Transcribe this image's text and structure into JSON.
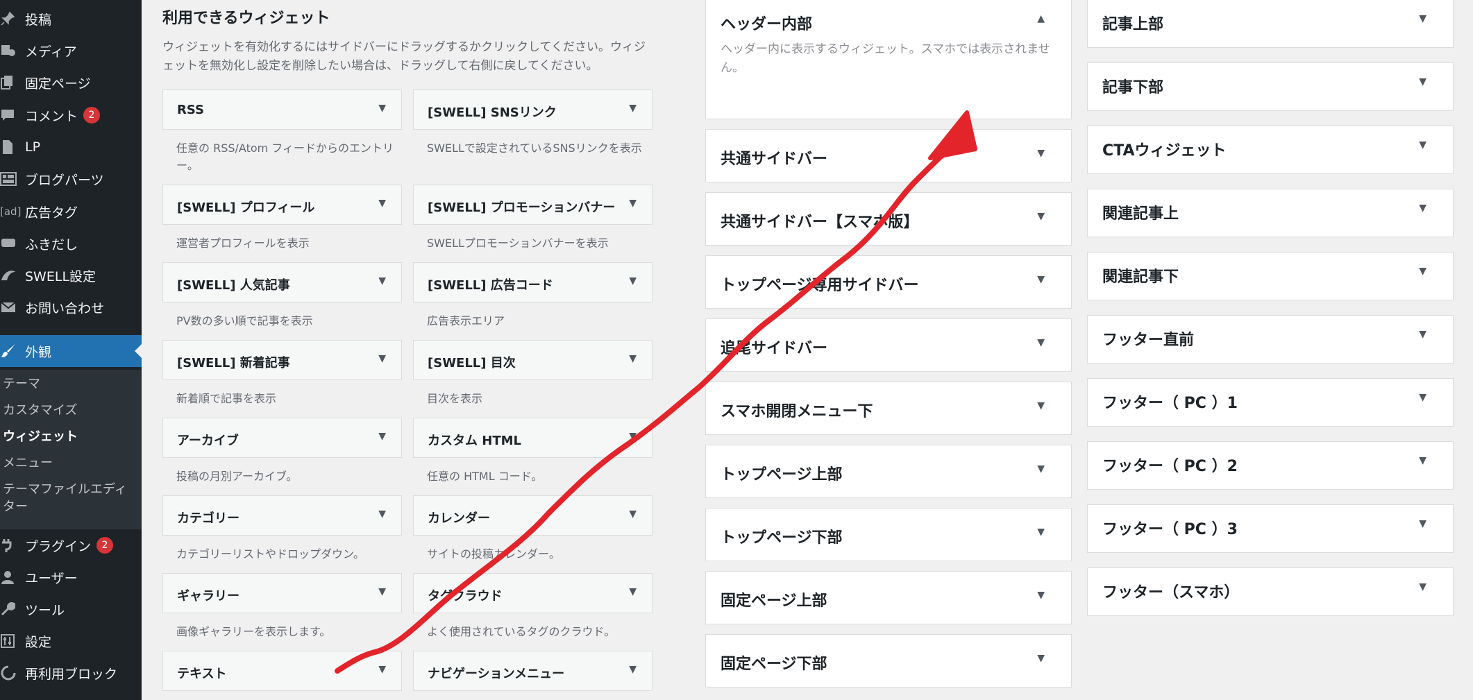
{
  "colors": {
    "admin_sidebar": "#1d2327",
    "admin_submenu": "#2c3338",
    "current_menu": "#2271b1",
    "badge": "#d63638",
    "annotation_arrow": "#e3242b"
  },
  "sidebar": {
    "items": [
      {
        "label": "投稿",
        "icon": "pin-icon"
      },
      {
        "label": "メディア",
        "icon": "media-icon"
      },
      {
        "label": "固定ページ",
        "icon": "pages-icon"
      },
      {
        "label": "コメント",
        "icon": "comment-icon",
        "badge": "2"
      },
      {
        "label": "LP",
        "icon": "document-icon"
      },
      {
        "label": "ブログパーツ",
        "icon": "grid-icon"
      },
      {
        "label": "広告タグ",
        "icon": "ad-icon",
        "icon_text": "[ad]"
      },
      {
        "label": "ふきだし",
        "icon": "speech-bubble-icon"
      },
      {
        "label": "SWELL設定",
        "icon": "swell-icon"
      },
      {
        "label": "お問い合わせ",
        "icon": "mail-icon"
      },
      {
        "label": "外観",
        "icon": "brush-icon"
      },
      {
        "label": "プラグイン",
        "icon": "plugin-icon",
        "badge": "2"
      },
      {
        "label": "ユーザー",
        "icon": "user-icon"
      },
      {
        "label": "ツール",
        "icon": "wrench-icon"
      },
      {
        "label": "設定",
        "icon": "settings-icon"
      },
      {
        "label": "再利用ブロック",
        "icon": "reusable-block-icon"
      }
    ],
    "submenu": [
      "テーマ",
      "カスタマイズ",
      "ウィジェット",
      "メニュー",
      "テーマファイルエディター"
    ]
  },
  "available": {
    "title": "利用できるウィジェット",
    "description": "ウィジェットを有効化するにはサイドバーにドラッグするかクリックしてください。ウィジェットを無効化し設定を削除したい場合は、ドラッグして右側に戻してください。",
    "widgets": [
      {
        "title": "RSS",
        "desc": "任意の RSS/Atom フィードからのエントリー。"
      },
      {
        "title": "[SWELL] SNSリンク",
        "desc": "SWELLで設定されているSNSリンクを表示"
      },
      {
        "title": "[SWELL] プロフィール",
        "desc": "運営者プロフィールを表示"
      },
      {
        "title": "[SWELL] プロモーションバナー",
        "desc": "SWELLプロモーションバナーを表示"
      },
      {
        "title": "[SWELL] 人気記事",
        "desc": "PV数の多い順で記事を表示"
      },
      {
        "title": "[SWELL] 広告コード",
        "desc": "広告表示エリア"
      },
      {
        "title": "[SWELL] 新着記事",
        "desc": "新着順で記事を表示"
      },
      {
        "title": "[SWELL] 目次",
        "desc": "目次を表示"
      },
      {
        "title": "アーカイブ",
        "desc": "投稿の月別アーカイブ。"
      },
      {
        "title": "カスタム HTML",
        "desc": "任意の HTML コード。"
      },
      {
        "title": "カテゴリー",
        "desc": "カテゴリーリストやドロップダウン。"
      },
      {
        "title": "カレンダー",
        "desc": "サイトの投稿カレンダー。"
      },
      {
        "title": "ギャラリー",
        "desc": "画像ギャラリーを表示します。"
      },
      {
        "title": "タグクラウド",
        "desc": "よく使用されているタグのクラウド。"
      },
      {
        "title": "テキスト",
        "desc": ""
      },
      {
        "title": "ナビゲーションメニュー",
        "desc": ""
      }
    ]
  },
  "areas_col1": [
    {
      "title": "ヘッダー内部",
      "desc": "ヘッダー内に表示するウィジェット。スマホでは表示されません。",
      "expanded": true
    },
    {
      "title": "共通サイドバー"
    },
    {
      "title": "共通サイドバー【スマホ版】"
    },
    {
      "title": "トップページ専用サイドバー"
    },
    {
      "title": "追尾サイドバー"
    },
    {
      "title": "スマホ開閉メニュー下"
    },
    {
      "title": "トップページ上部"
    },
    {
      "title": "トップページ下部"
    },
    {
      "title": "固定ページ上部"
    },
    {
      "title": "固定ページ下部"
    }
  ],
  "areas_col2": [
    {
      "title": "記事上部"
    },
    {
      "title": "記事下部"
    },
    {
      "title": "CTAウィジェット"
    },
    {
      "title": "関連記事上"
    },
    {
      "title": "関連記事下"
    },
    {
      "title": "フッター直前"
    },
    {
      "title": "フッター（ PC ）1"
    },
    {
      "title": "フッター（ PC ）2"
    },
    {
      "title": "フッター（ PC ）3"
    },
    {
      "title": "フッター（スマホ）"
    }
  ],
  "toggle_glyphs": {
    "collapsed": "▼",
    "expanded": "▲"
  }
}
